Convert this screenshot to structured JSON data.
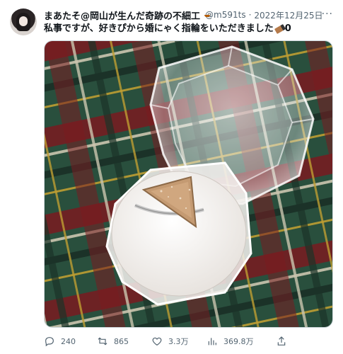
{
  "tweet": {
    "author_name": "まあたそ@岡山が生んだ奇跡の不細工",
    "handle": "@m591ts",
    "separator": "·",
    "date": "2022年12月25日",
    "text": "私事ですが、好きぴから婚にゃく指輪をいただきました",
    "text_suffix": "0",
    "more_label": "···"
  },
  "actions": {
    "replies": "240",
    "retweets": "865",
    "likes": "3.3万",
    "views": "369.8万"
  },
  "icons": {
    "reply": "reply-icon",
    "retweet": "retweet-icon",
    "like": "heart-icon",
    "views": "views-chart-icon",
    "share": "share-icon",
    "more": "more-icon"
  },
  "colors": {
    "text_primary": "#0f1419",
    "text_secondary": "#536471"
  }
}
